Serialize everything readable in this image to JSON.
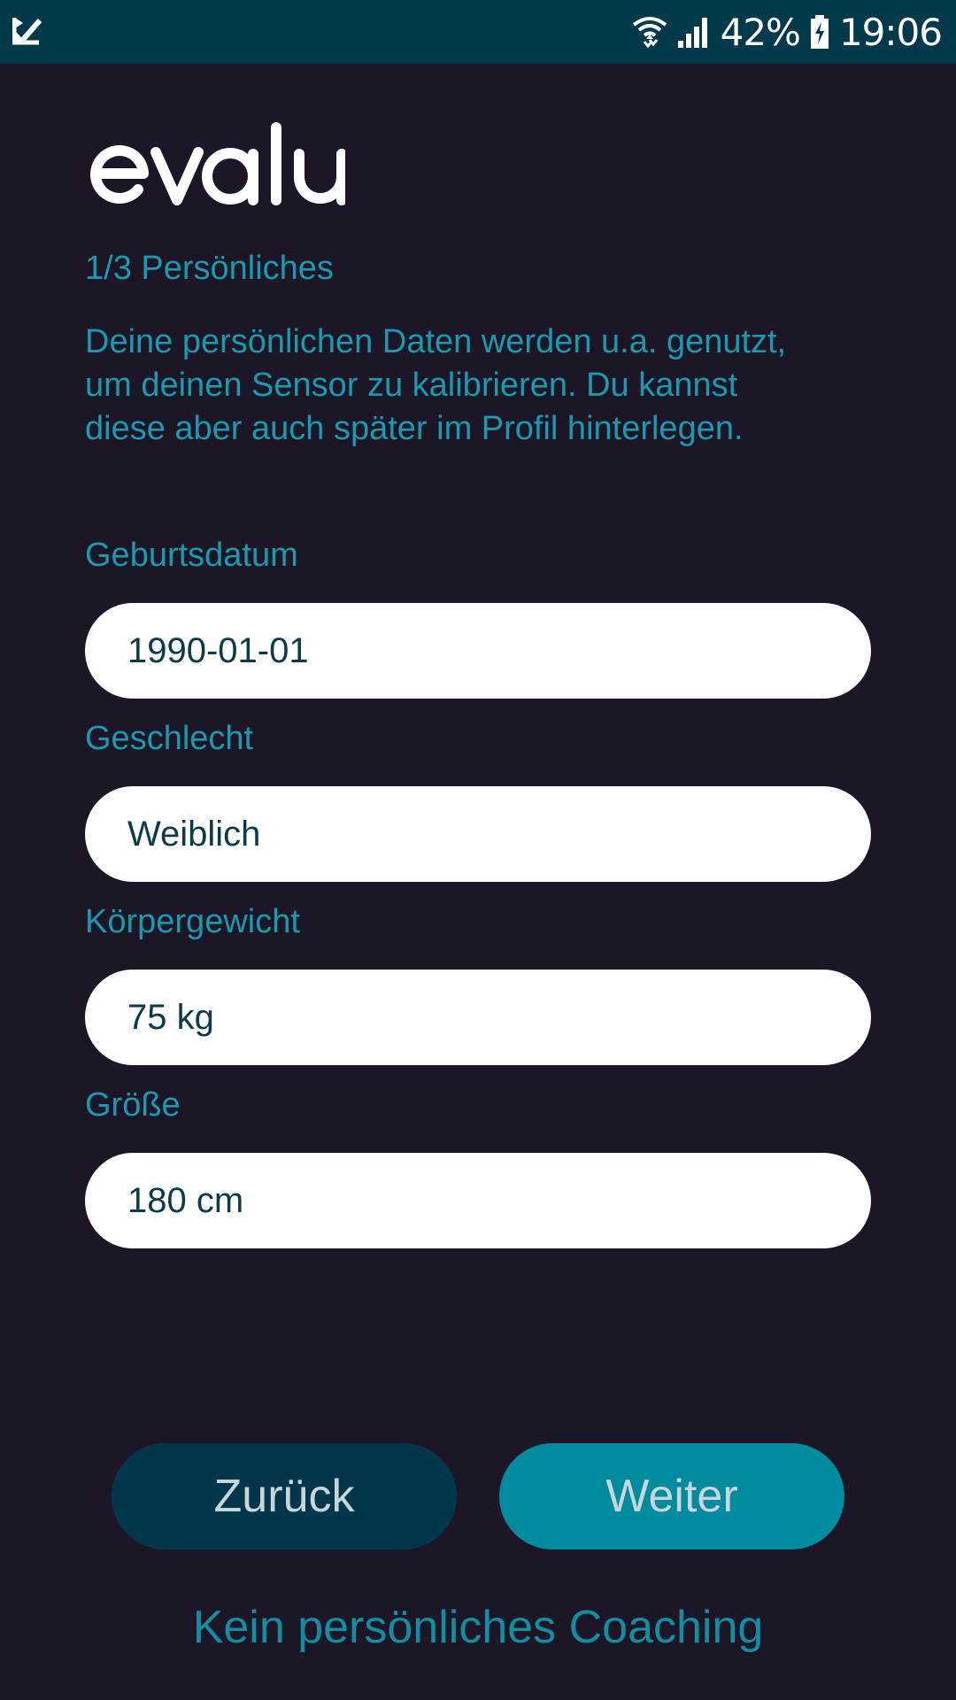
{
  "status_bar": {
    "app_icon": "checkmark-notification-icon",
    "wifi_icon": "wifi-icon",
    "signal_icon": "signal-icon",
    "battery_icon": "battery-charging-icon",
    "battery": "42%",
    "time": "19:06"
  },
  "logo": {
    "text": "evalu"
  },
  "header": {
    "step": "1/3 Persönliches",
    "intro_line1": "Deine persönlichen Daten werden u.a. genutzt,",
    "intro_line2": "um deinen Sensor zu kalibrieren. Du kannst",
    "intro_line3": "diese aber auch später im Profil hinterlegen."
  },
  "form": {
    "birthdate": {
      "label": "Geburtsdatum",
      "value": "1990-01-01"
    },
    "gender": {
      "label": "Geschlecht",
      "value": "Weiblich"
    },
    "weight": {
      "label": "Körpergewicht",
      "value": "75 kg"
    },
    "height": {
      "label": "Größe",
      "value": "180 cm"
    }
  },
  "actions": {
    "back_label": "Zurück",
    "next_label": "Weiter",
    "no_coaching_label": "Kein persönliches Coaching"
  },
  "colors": {
    "background": "#1c1626",
    "status_bar": "#023a4c",
    "accent_text": "#1a9aae",
    "button_back": "#02374b",
    "button_next": "#008b9e",
    "input_background": "#ffffff",
    "input_text": "#0c3a4a"
  }
}
